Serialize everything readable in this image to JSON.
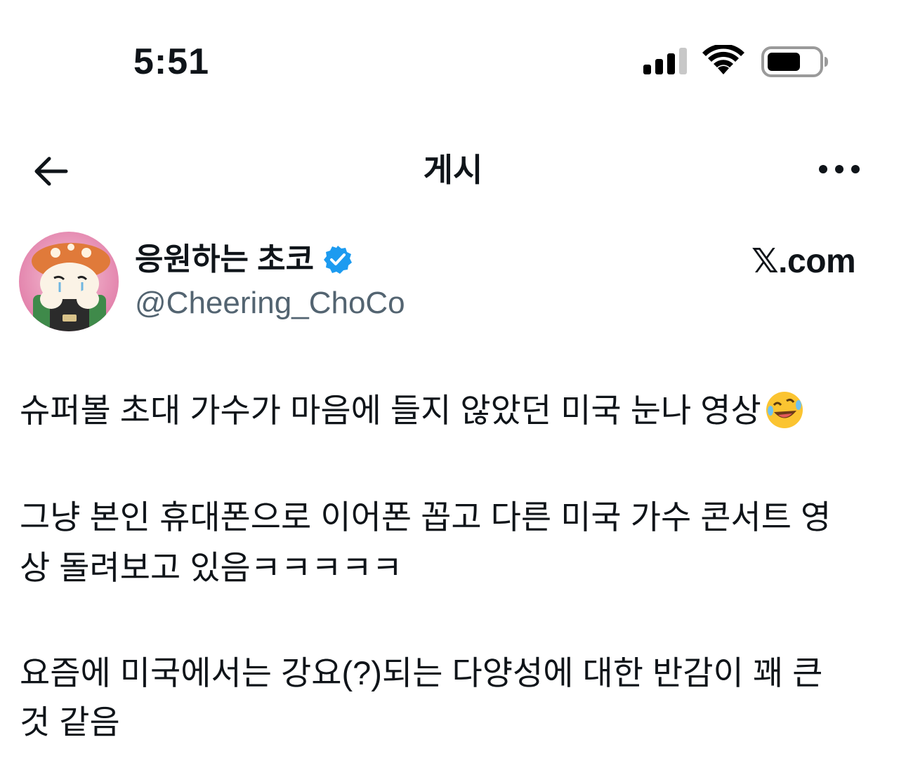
{
  "status_bar": {
    "time": "5:51",
    "icons": [
      "cellular-signal-icon",
      "wifi-icon",
      "battery-icon"
    ]
  },
  "nav": {
    "title": "게시",
    "back_icon": "back-arrow-icon",
    "more_icon": "more-options-icon"
  },
  "author": {
    "display_name": "응원하는 초코",
    "verified": true,
    "handle": "@Cheering_ChoCo",
    "source": "𝕏.com"
  },
  "tweet": {
    "line1": "슈퍼볼 초대 가수가 마음에 들지 않았던 미국 눈나 영상",
    "line1_emoji": "rolling-on-floor-laughing-emoji",
    "line2": "그냥 본인 휴대폰으로 이어폰 꼽고 다른 미국 가수 콘서트 영",
    "line3": "상 돌려보고 있음ㅋㅋㅋㅋㅋ",
    "line4": "요즘에 미국에서는 강요(?)되는 다양성에 대한 반감이 꽤 큰",
    "line5": "것 같음"
  },
  "colors": {
    "text": "#0f1419",
    "secondary_text": "#536471",
    "verified_blue": "#1d9bf0"
  }
}
